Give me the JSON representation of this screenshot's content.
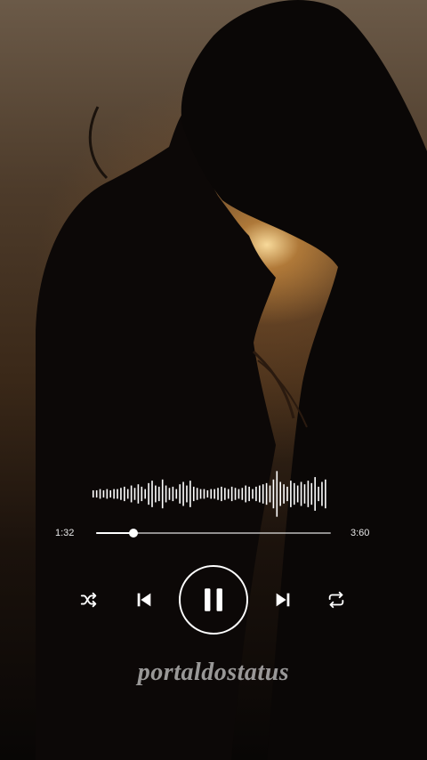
{
  "player": {
    "current_time": "1:32",
    "total_time": "3:60",
    "progress": 0.16,
    "waveform_levels": [
      0.15,
      0.15,
      0.2,
      0.15,
      0.2,
      0.15,
      0.2,
      0.2,
      0.25,
      0.3,
      0.2,
      0.35,
      0.25,
      0.4,
      0.3,
      0.2,
      0.45,
      0.55,
      0.35,
      0.3,
      0.6,
      0.35,
      0.25,
      0.3,
      0.2,
      0.4,
      0.5,
      0.35,
      0.55,
      0.3,
      0.25,
      0.2,
      0.2,
      0.15,
      0.2,
      0.2,
      0.25,
      0.3,
      0.25,
      0.2,
      0.3,
      0.25,
      0.2,
      0.25,
      0.35,
      0.3,
      0.2,
      0.3,
      0.35,
      0.4,
      0.45,
      0.35,
      0.6,
      0.95,
      0.5,
      0.4,
      0.3,
      0.55,
      0.45,
      0.35,
      0.5,
      0.4,
      0.55,
      0.45,
      0.7,
      0.3,
      0.5,
      0.6
    ],
    "controls": {
      "shuffle_icon": "shuffle-icon",
      "prev_icon": "skip-previous-icon",
      "play_pause_icon": "pause-icon",
      "next_icon": "skip-next-icon",
      "repeat_icon": "repeat-icon"
    },
    "colors": {
      "accent": "#ffffff"
    }
  },
  "watermark": "portaldostatus"
}
